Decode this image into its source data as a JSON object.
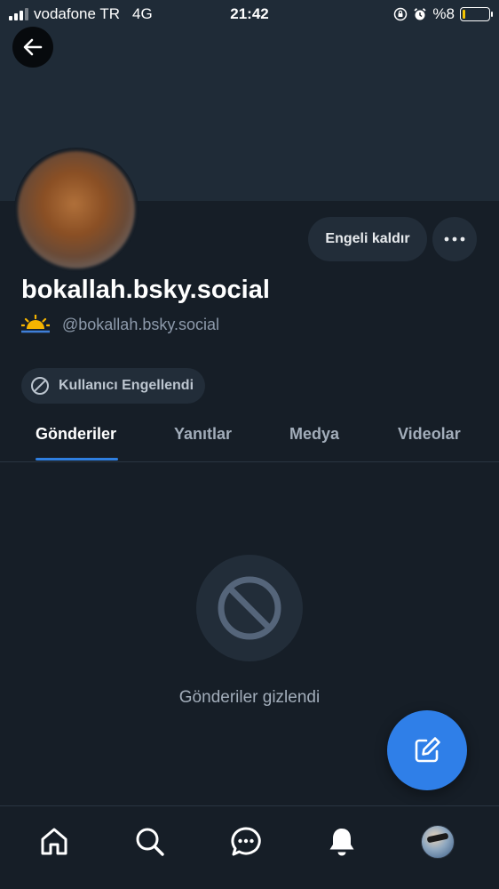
{
  "status_bar": {
    "carrier": "vodafone TR",
    "network": "4G",
    "time": "21:42",
    "battery_percent": "%8",
    "battery_level": 0.08
  },
  "profile": {
    "display_name": "bokallah.bsky.social",
    "handle": "@bokallah.bsky.social",
    "unblock_label": "Engeli kaldır",
    "blocked_badge": "Kullanıcı Engellendi"
  },
  "tabs": [
    {
      "label": "Gönderiler",
      "active": true
    },
    {
      "label": "Yanıtlar",
      "active": false
    },
    {
      "label": "Medya",
      "active": false
    },
    {
      "label": "Videolar",
      "active": false
    }
  ],
  "empty_state": {
    "text": "Gönderiler gizlendi"
  },
  "bottom_nav": {
    "items": [
      "home-icon",
      "search-icon",
      "chat-icon",
      "bell-icon",
      "avatar"
    ]
  },
  "colors": {
    "background": "#161e27",
    "banner": "#1f2b37",
    "accent": "#2f7fe8",
    "pill": "#222d39"
  }
}
